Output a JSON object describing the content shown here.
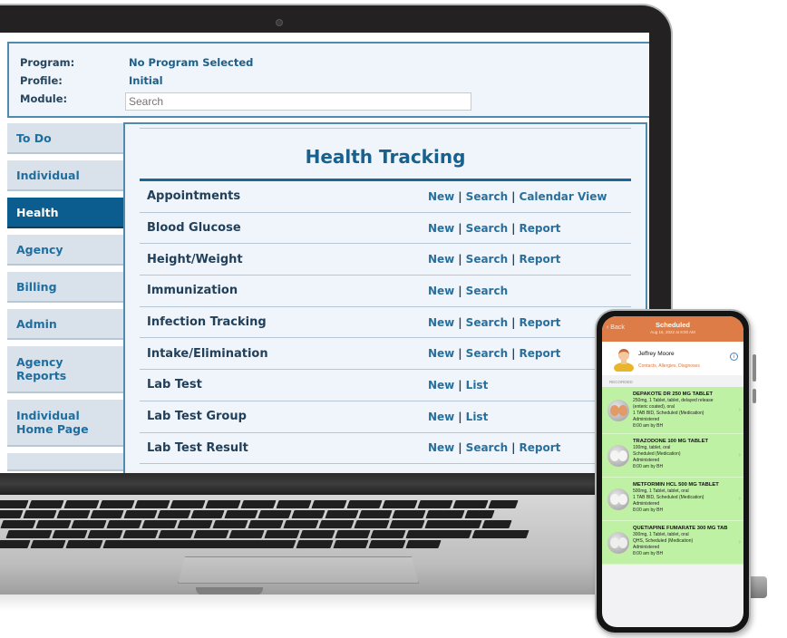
{
  "header": {
    "program_label": "Program:",
    "program_value": "No Program Selected",
    "profile_label": "Profile:",
    "profile_value": "Initial",
    "module_label": "Module:",
    "module_search_placeholder": "Search"
  },
  "sidebar": {
    "items": [
      {
        "label": "To Do",
        "active": false
      },
      {
        "label": "Individual",
        "active": false
      },
      {
        "label": "Health",
        "active": true
      },
      {
        "label": "Agency",
        "active": false
      },
      {
        "label": "Billing",
        "active": false
      },
      {
        "label": "Admin",
        "active": false
      },
      {
        "label": "Agency\nReports",
        "active": false
      },
      {
        "label": "Individual\nHome Page",
        "active": false
      }
    ]
  },
  "main": {
    "title": "Health Tracking",
    "rows": [
      {
        "name": "Appointments",
        "links": [
          "New",
          "Search",
          "Calendar View"
        ]
      },
      {
        "name": "Blood Glucose",
        "links": [
          "New",
          "Search",
          "Report"
        ]
      },
      {
        "name": "Height/Weight",
        "links": [
          "New",
          "Search",
          "Report"
        ]
      },
      {
        "name": "Immunization",
        "links": [
          "New",
          "Search"
        ]
      },
      {
        "name": "Infection Tracking",
        "links": [
          "New",
          "Search",
          "Report"
        ]
      },
      {
        "name": "Intake/Elimination",
        "links": [
          "New",
          "Search",
          "Report"
        ]
      },
      {
        "name": "Lab Test",
        "links": [
          "New",
          "List"
        ]
      },
      {
        "name": "Lab Test Group",
        "links": [
          "New",
          "List"
        ]
      },
      {
        "name": "Lab Test Result",
        "links": [
          "New",
          "Search",
          "Report"
        ]
      }
    ],
    "link_separator": "|"
  },
  "phone": {
    "back_label": "Back",
    "title": "Scheduled",
    "subtitle": "Aug 16, 2022 at 8:00 AM",
    "patient_name": "Jeffrey Moore",
    "patient_links": "Contacts, Allergies, Diagnoses",
    "info_icon": "i",
    "section_label": "RECORDED",
    "chevron": "›",
    "medications": [
      {
        "name": "DEPAKOTE DR 250 MG TABLET",
        "lines": [
          "250mg, 1 Tablet, tablet, delayed release",
          "(enteric coated), oral",
          "1 TAB BID, Scheduled (Medication)",
          "Administered",
          "8:00 am by BH"
        ],
        "pill_color": "#e29a66"
      },
      {
        "name": "TRAZODONE 100 MG TABLET",
        "lines": [
          "100mg, tablet, oral",
          "Scheduled (Medication)",
          "Administered",
          "8:00 am by BH"
        ],
        "pill_color": "#f4f4f4"
      },
      {
        "name": "METFORMIN HCL 500 MG TABLET",
        "lines": [
          "500mg, 1 Tablet, tablet, oral",
          "1 TAB BID, Scheduled (Medication)",
          "Administered",
          "8:00 am by BH"
        ],
        "pill_color": "#f4f4f4"
      },
      {
        "name": "QUETIAPINE FUMARATE 300 MG TAB",
        "lines": [
          "300mg, 1 Tablet, tablet, oral",
          "QHS, Scheduled (Medication)",
          "Administered",
          "8:00 am by BH"
        ],
        "pill_color": "#eeeeee"
      }
    ]
  },
  "colors": {
    "sidebar_active": "#0b5d8f",
    "sidebar_item_bg": "#d9e2ea",
    "title_blue": "#17618f",
    "link_blue": "#2a6f9c",
    "phone_header": "#dd7c46",
    "med_row_bg": "#bff1a4"
  }
}
